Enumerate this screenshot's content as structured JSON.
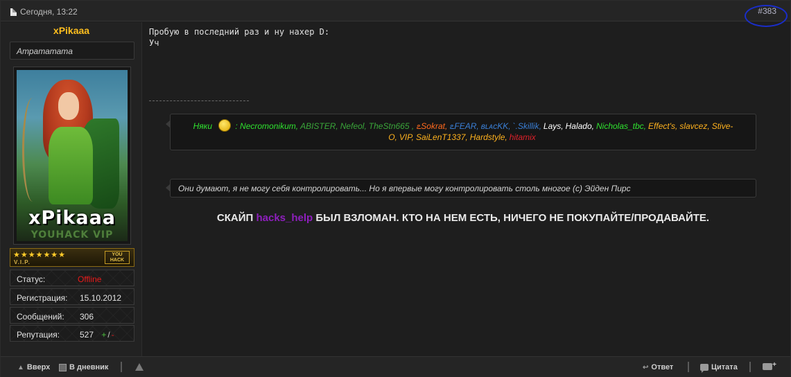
{
  "header": {
    "date": "Сегодня, 13:22",
    "post_number": "#383"
  },
  "user": {
    "username": "xPikaaa",
    "title": "Атратататa",
    "avatar_name": "xPikaaa",
    "avatar_subtitle": "YOUHACK VIP",
    "vip_stars": "★★★★★★★",
    "vip_text": "V.I.P.",
    "vip_badge": "YOU HACK",
    "stats": [
      {
        "label": "Статус:",
        "value": "Offline"
      },
      {
        "label": "Регистрация:",
        "value": "15.10.2012"
      },
      {
        "label": "Сообщений:",
        "value": "306"
      },
      {
        "label": "Репутация:",
        "value": "527"
      }
    ],
    "rep_plus": "+",
    "rep_sep": "/",
    "rep_minus": "-"
  },
  "message": {
    "line1": "Пробую в последний раз и ну нахер D:",
    "line2": "Уч"
  },
  "signature": {
    "thanks_label": "Няки",
    "names": [
      {
        "text": ": Necromonikum,",
        "color": "#2fe32f"
      },
      {
        "text": "ABISTER,",
        "color": "#3aa63a"
      },
      {
        "text": "Nefeol,",
        "color": "#3aa63a"
      },
      {
        "text": "TheStn665 ,",
        "color": "#3aa63a"
      },
      {
        "text": "ఽSokrat,",
        "color": "#ff6a1e"
      },
      {
        "text": "ఽFEAR,",
        "color": "#3a7fd6"
      },
      {
        "text": "ʙʟᴀᴄKK,",
        "color": "#3a7fd6"
      },
      {
        "text": "`.Skillik,",
        "color": "#3a7fd6"
      },
      {
        "text": "Lays,",
        "color": "#ffffff"
      },
      {
        "text": "Halado,",
        "color": "#ffffff"
      },
      {
        "text": "Nicholas_tbc,",
        "color": "#2fe32f"
      },
      {
        "text": "Effect's,",
        "color": "#ffb21e"
      },
      {
        "text": "slavcez,",
        "color": "#ffb21e"
      },
      {
        "text": "Stive-O,",
        "color": "#ffb21e"
      },
      {
        "text": "VIP,",
        "color": "#ffb21e"
      },
      {
        "text": "SaiLenT1337,",
        "color": "#ffb21e"
      },
      {
        "text": "Hardstyle,",
        "color": "#ffb21e"
      },
      {
        "text": "hitamix",
        "color": "#e0202a"
      }
    ],
    "quote": "Они думают, я не могу себя контролировать... Но я впервые могу контролировать столь многое (с) Эйден Пирс",
    "alert_before": "СКАЙП",
    "alert_highlight": "hacks_help",
    "alert_after": "БЫЛ ВЗЛОМАН. КТО НА НЕМ ЕСТЬ, НИЧЕГО НЕ ПОКУПАЙТЕ/ПРОДАВАЙТЕ."
  },
  "footer": {
    "up": "Вверх",
    "diary": "В дневник",
    "reply": "Ответ",
    "quote": "Цитата"
  },
  "colors": {
    "username": "#ffbf1e",
    "offline": "#e81a1a",
    "alert_highlight": "#8e1fbd",
    "annotation_circle": "#1a2dc9"
  }
}
